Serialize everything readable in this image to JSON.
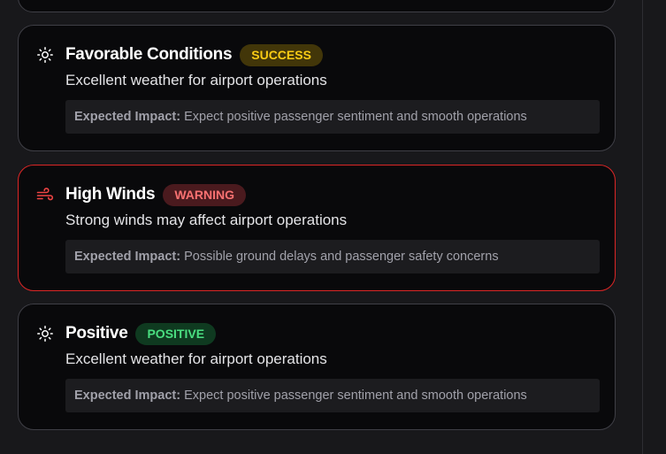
{
  "alerts": [
    {
      "icon": "sun-icon",
      "title": "Favorable Conditions",
      "badge": "SUCCESS",
      "description": "Excellent weather for airport operations",
      "impact_label": "Expected Impact:",
      "impact_text": "Expect positive passenger sentiment and smooth operations"
    },
    {
      "icon": "wind-icon",
      "title": "High Winds",
      "badge": "WARNING",
      "description": "Strong winds may affect airport operations",
      "impact_label": "Expected Impact:",
      "impact_text": "Possible ground delays and passenger safety concerns"
    },
    {
      "icon": "sun-icon",
      "title": "Positive",
      "badge": "POSITIVE",
      "description": "Excellent weather for airport operations",
      "impact_label": "Expected Impact:",
      "impact_text": "Expect positive passenger sentiment and smooth operations"
    }
  ],
  "colors": {
    "background": "#18181b",
    "card": "#09090b",
    "warning_border": "#dc2626",
    "success_text": "#facc15",
    "warning_text": "#f87171",
    "positive_text": "#4ade80"
  }
}
